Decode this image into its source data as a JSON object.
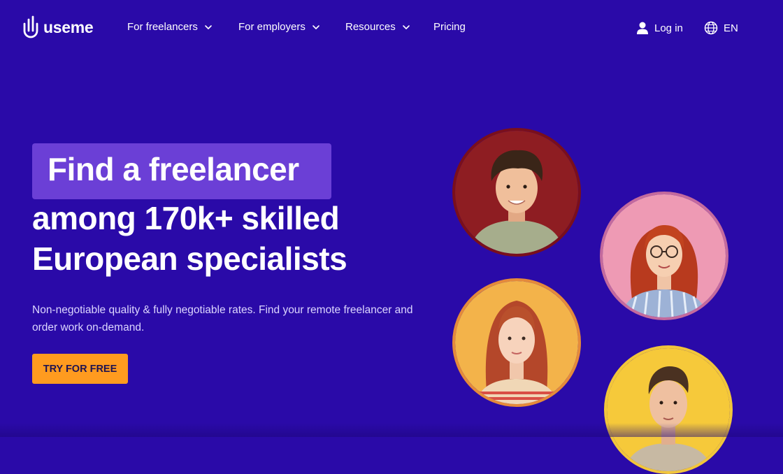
{
  "brand": {
    "name": "useme"
  },
  "nav": {
    "items": [
      {
        "label": "For freelancers",
        "has_dropdown": true
      },
      {
        "label": "For employers",
        "has_dropdown": true
      },
      {
        "label": "Resources",
        "has_dropdown": true
      },
      {
        "label": "Pricing",
        "has_dropdown": false
      }
    ],
    "login_label": "Log in",
    "language": "EN"
  },
  "hero": {
    "highlight": "Find a freelancer",
    "line2": "among 170k+ skilled",
    "line3": "European specialists",
    "subtitle": "Non-negotiable quality & fully negotiable rates. Find your remote freelancer and order work on-demand.",
    "cta_label": "TRY FOR FREE"
  },
  "colors": {
    "background": "#2a0aa8",
    "highlight_box": "#6b3fd6",
    "cta": "#ff9b1f"
  },
  "icons": [
    "useme-logo-icon",
    "chevron-down-icon",
    "user-icon",
    "globe-icon"
  ]
}
